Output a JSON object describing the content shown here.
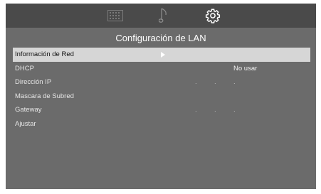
{
  "tabs": [
    {
      "icon": "keypad-grid-icon"
    },
    {
      "icon": "music-note-icon"
    },
    {
      "icon": "gear-icon",
      "active": true
    }
  ],
  "page_title": "Configuración de LAN",
  "menu": [
    {
      "label": "Información de Red",
      "selected": true
    },
    {
      "label": "DHCP",
      "value": "No usar"
    },
    {
      "label": "Dirección IP",
      "value": ". . ."
    },
    {
      "label": "Mascara de Subred"
    },
    {
      "label": "Gateway",
      "value": ". . ."
    },
    {
      "label": "Ajustar"
    }
  ],
  "colors": {
    "screen_bg": "#6b6b6b",
    "topbar_bg": "#4a4a4a",
    "selected_row": "#d6d6d6"
  }
}
